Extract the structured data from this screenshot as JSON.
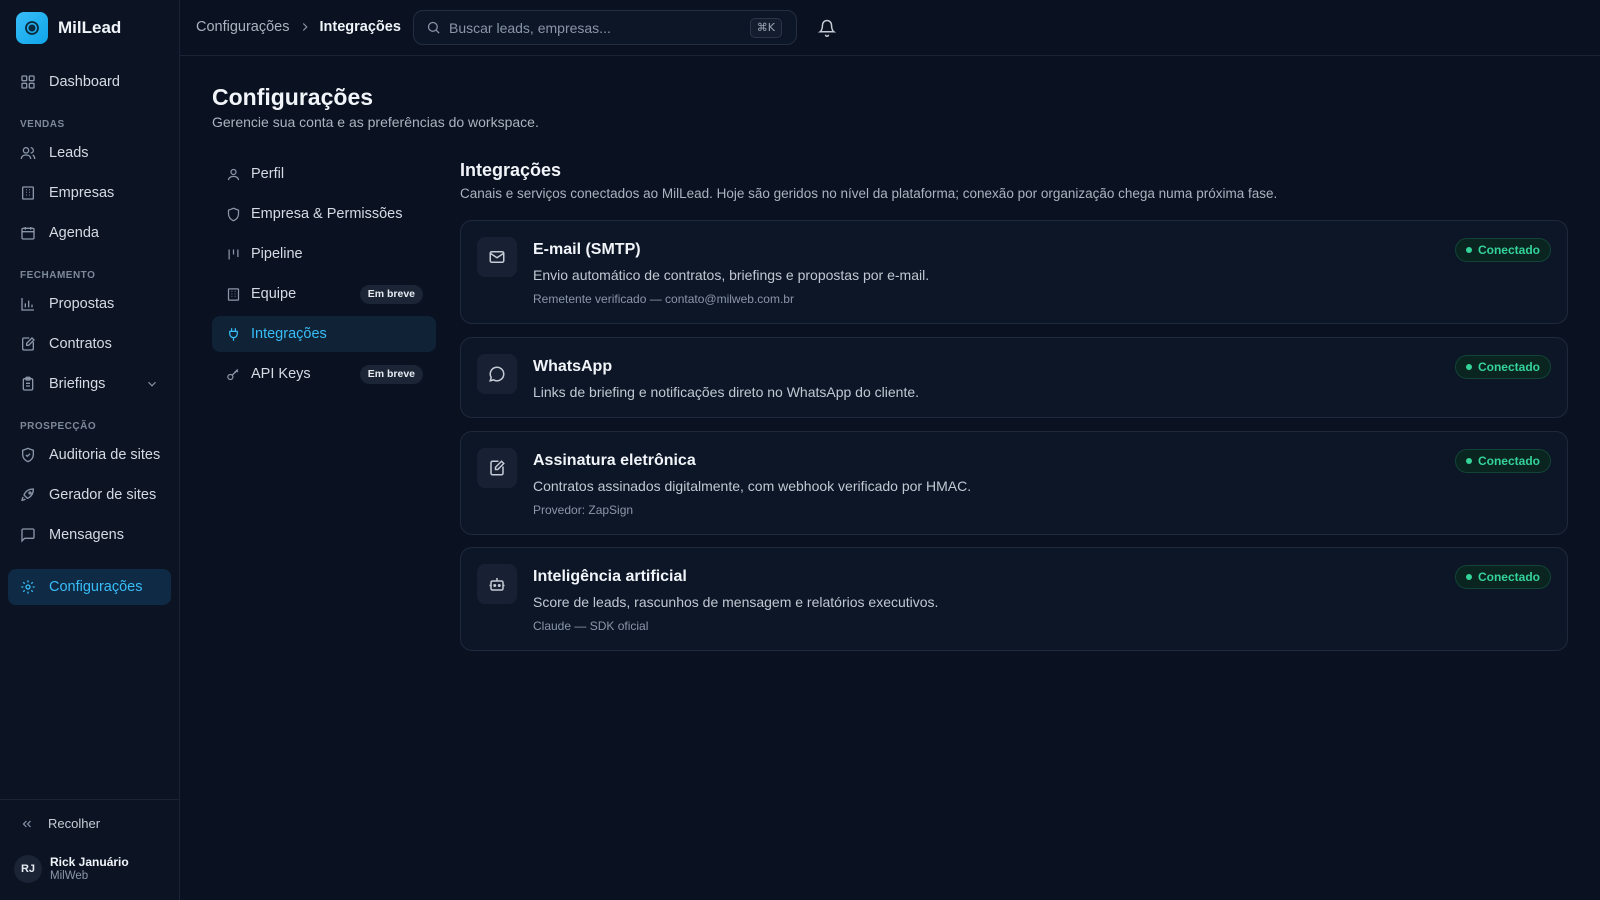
{
  "app": {
    "name": "MilLead"
  },
  "sidebar": {
    "dashboard": "Dashboard",
    "sections": {
      "vendas": "VENDAS",
      "fechamento": "FECHAMENTO",
      "prospeccao": "PROSPECÇÃO"
    },
    "items": {
      "leads": "Leads",
      "empresas": "Empresas",
      "agenda": "Agenda",
      "propostas": "Propostas",
      "contratos": "Contratos",
      "briefings": "Briefings",
      "auditoria": "Auditoria de sites",
      "gerador": "Gerador de sites",
      "mensagens": "Mensagens",
      "configuracoes": "Configurações"
    },
    "collapse_label": "Recolher",
    "user": {
      "initials": "RJ",
      "name": "Rick Januário",
      "org": "MilWeb"
    }
  },
  "topbar": {
    "breadcrumb": [
      "Configurações",
      "Integrações"
    ],
    "search_placeholder": "Buscar leads, empresas...",
    "shortcut": "⌘K"
  },
  "page": {
    "title": "Configurações",
    "subtitle": "Gerencie sua conta e as preferências do workspace."
  },
  "settings_nav": {
    "soon_label": "Em breve",
    "items": {
      "perfil": "Perfil",
      "empresa": "Empresa & Permissões",
      "pipeline": "Pipeline",
      "equipe": "Equipe",
      "integracoes": "Integrações",
      "api_keys": "API Keys"
    }
  },
  "integrations": {
    "title": "Integrações",
    "subtitle": "Canais e serviços conectados ao MilLead. Hoje são geridos no nível da plataforma; conexão por organização chega numa próxima fase.",
    "status_label": "Conectado",
    "cards": [
      {
        "icon": "mail-icon",
        "title": "E-mail (SMTP)",
        "description": "Envio automático de contratos, briefings e propostas por e-mail.",
        "meta": "Remetente verificado — contato@milweb.com.br",
        "status": "Conectado"
      },
      {
        "icon": "chat-icon",
        "title": "WhatsApp",
        "description": "Links de briefing e notificações direto no WhatsApp do cliente.",
        "meta": "",
        "status": "Conectado"
      },
      {
        "icon": "signature-icon",
        "title": "Assinatura eletrônica",
        "description": "Contratos assinados digitalmente, com webhook verificado por HMAC.",
        "meta": "Provedor: ZapSign",
        "status": "Conectado"
      },
      {
        "icon": "bot-icon",
        "title": "Inteligência artificial",
        "description": "Score de leads, rascunhos de mensagem e relatórios executivos.",
        "meta": "Claude — SDK oficial",
        "status": "Conectado"
      }
    ]
  },
  "colors": {
    "accent": "#38bdf8",
    "background": "#0a1120",
    "success": "#34d399"
  }
}
